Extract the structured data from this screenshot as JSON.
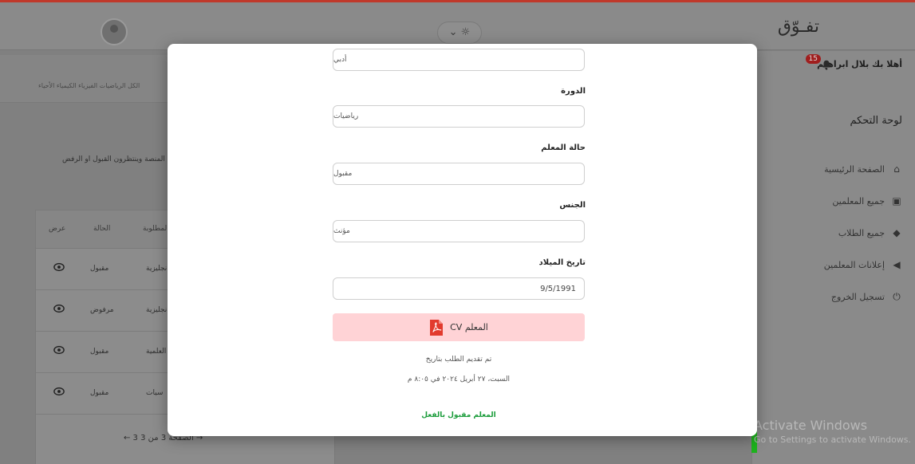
{
  "app": {
    "logo": "تفـوّق",
    "theme_toggle": "⌄ ☼"
  },
  "user": {
    "greeting": "أهلا بك بلال ابراهيم",
    "notifications": "15"
  },
  "sidebar": {
    "title": "لوحة التحكم",
    "items": [
      {
        "label": "الصفحة الرئيسية",
        "icon": "home-icon"
      },
      {
        "label": "جميع المعلمين",
        "icon": "teacher-board-icon"
      },
      {
        "label": "جميع الطلاب",
        "icon": "graduation-cap-icon"
      },
      {
        "label": "إعلانات المعلمين",
        "icon": "megaphone-icon"
      },
      {
        "label": "تسجيل الخروج",
        "icon": "power-icon"
      }
    ]
  },
  "background": {
    "tabs_row": "الكل   الرياضيات   الفيزياء   الكيمياء   الأحياء",
    "description": "المنصة وينتظرون القبول او الرفض",
    "table_headers": {
      "view": "عرض",
      "status": "الحالة",
      "subject": "المطلوبة"
    },
    "rows": [
      {
        "status": "مقبول",
        "subject": "انجليزية"
      },
      {
        "status": "مرفوض",
        "subject": "انجليزية"
      },
      {
        "status": "مقبول",
        "subject": "العلمية"
      },
      {
        "status": "مقبول",
        "subject": "سيات"
      }
    ],
    "pager": "← 3 الصفحة 3 من 3 →"
  },
  "modal": {
    "top_value": "أدبي",
    "fields": [
      {
        "label": "الدورة",
        "value": "رياضيات"
      },
      {
        "label": "حالة المعلم",
        "value": "مقبول"
      },
      {
        "label": "الجنس",
        "value": "مؤنث"
      },
      {
        "label": "تاريخ الميلاد",
        "value": "9/5/1991"
      }
    ],
    "cv_button": "CV المعلم",
    "submitted_label": "تم تقديم الطلب بتاريخ",
    "submitted_date": "السبت، ٢٧ أبريل ٢٠٢٤ في ٨:٠٥ م",
    "accepted_text": "المعلم مقبول بالفعل"
  },
  "watermark": {
    "title": "Activate Windows",
    "subtitle": "Go to Settings to activate Windows."
  },
  "colors": {
    "accent_red": "#c0392b",
    "cv_bg": "#ffd3d6",
    "success_green": "#1a9c3a",
    "bar_green": "#1db31d"
  }
}
